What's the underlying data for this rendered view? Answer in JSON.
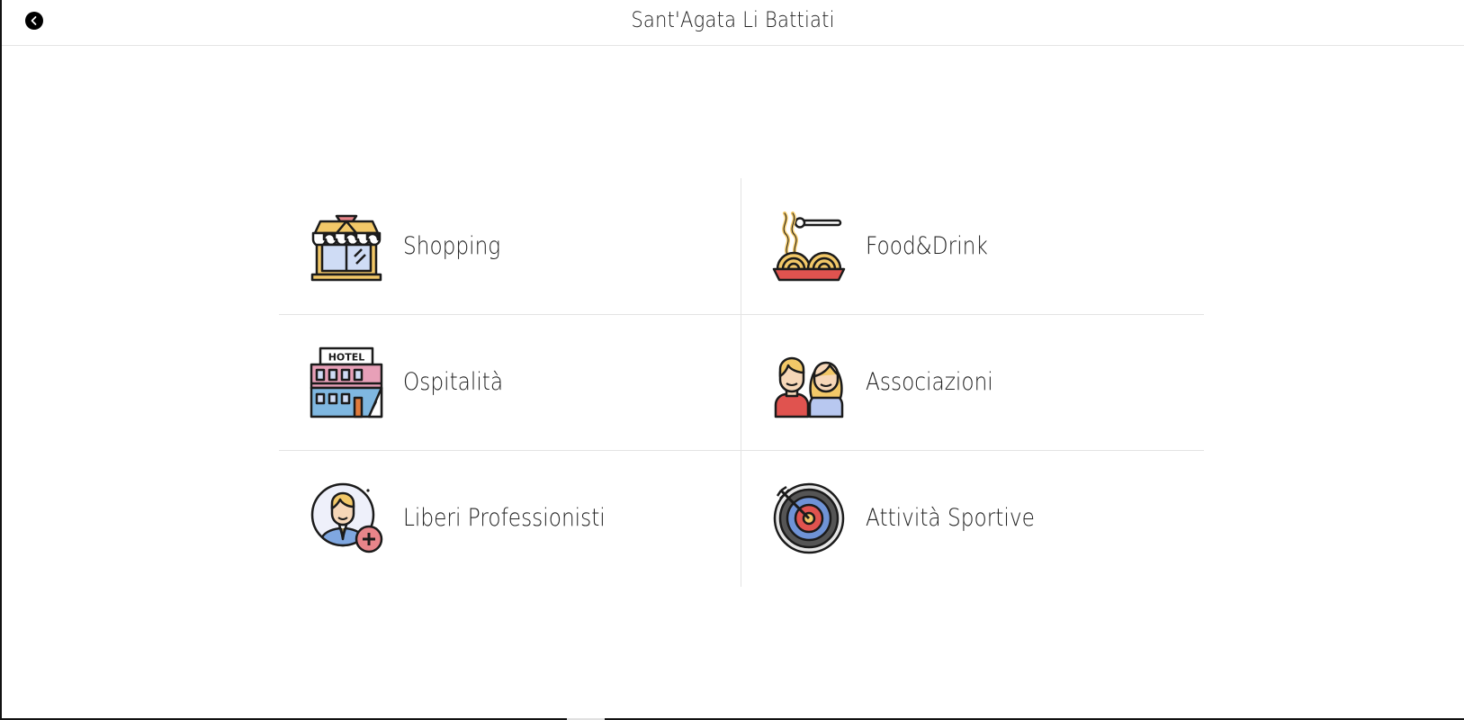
{
  "header": {
    "title": "Sant'Agata Li Battiati",
    "back_icon": "chevron-left-icon"
  },
  "categories": [
    {
      "label": "Shopping",
      "icon": "storefront-icon"
    },
    {
      "label": "Food&Drink",
      "icon": "spaghetti-icon"
    },
    {
      "label": "Ospitalità",
      "icon": "hotel-icon",
      "sign": "HOTEL"
    },
    {
      "label": "Associazioni",
      "icon": "people-icon"
    },
    {
      "label": "Liberi Professionisti",
      "icon": "professional-icon"
    },
    {
      "label": "Attività Sportive",
      "icon": "target-icon"
    }
  ],
  "colors": {
    "outline": "#1b1b1b",
    "yellow": "#f2c868",
    "pink": "#e8858a",
    "light_blue": "#cfdcf5",
    "blue": "#6f93d6",
    "red": "#e0534f"
  }
}
